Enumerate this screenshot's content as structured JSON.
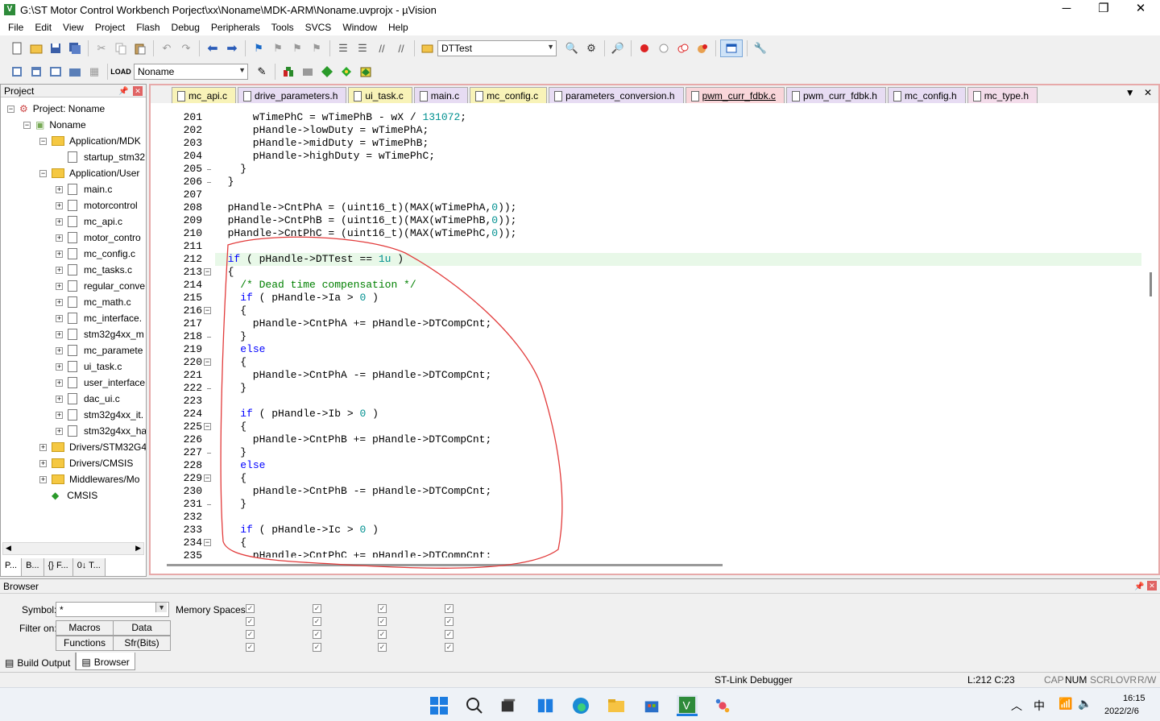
{
  "window": {
    "title": "G:\\ST Motor Control Workbench Porject\\xx\\Noname\\MDK-ARM\\Noname.uvprojx - µVision",
    "minimize": "─",
    "maximize": "❐",
    "close": "✕"
  },
  "menu": [
    "File",
    "Edit",
    "View",
    "Project",
    "Flash",
    "Debug",
    "Peripherals",
    "Tools",
    "SVCS",
    "Window",
    "Help"
  ],
  "toolbar": {
    "find_combo": "DTTest",
    "target_combo": "Noname"
  },
  "project": {
    "title": "Project",
    "tree": [
      {
        "label": "Project: Noname",
        "level": 0,
        "kind": "root",
        "exp": "−"
      },
      {
        "label": "Noname",
        "level": 1,
        "kind": "target",
        "exp": "−"
      },
      {
        "label": "Application/MDK",
        "level": 2,
        "kind": "folder",
        "exp": "−"
      },
      {
        "label": "startup_stm32",
        "level": 3,
        "kind": "file",
        "exp": ""
      },
      {
        "label": "Application/User",
        "level": 2,
        "kind": "folder",
        "exp": "−"
      },
      {
        "label": "main.c",
        "level": 3,
        "kind": "file",
        "exp": "+"
      },
      {
        "label": "motorcontrol",
        "level": 3,
        "kind": "file",
        "exp": "+"
      },
      {
        "label": "mc_api.c",
        "level": 3,
        "kind": "file",
        "exp": "+"
      },
      {
        "label": "motor_contro",
        "level": 3,
        "kind": "file",
        "exp": "+"
      },
      {
        "label": "mc_config.c",
        "level": 3,
        "kind": "file",
        "exp": "+"
      },
      {
        "label": "mc_tasks.c",
        "level": 3,
        "kind": "file",
        "exp": "+"
      },
      {
        "label": "regular_conve",
        "level": 3,
        "kind": "file",
        "exp": "+"
      },
      {
        "label": "mc_math.c",
        "level": 3,
        "kind": "file",
        "exp": "+"
      },
      {
        "label": "mc_interface.",
        "level": 3,
        "kind": "file",
        "exp": "+"
      },
      {
        "label": "stm32g4xx_m",
        "level": 3,
        "kind": "file",
        "exp": "+"
      },
      {
        "label": "mc_paramete",
        "level": 3,
        "kind": "file",
        "exp": "+"
      },
      {
        "label": "ui_task.c",
        "level": 3,
        "kind": "file",
        "exp": "+"
      },
      {
        "label": "user_interface",
        "level": 3,
        "kind": "file",
        "exp": "+"
      },
      {
        "label": "dac_ui.c",
        "level": 3,
        "kind": "file",
        "exp": "+"
      },
      {
        "label": "stm32g4xx_it.",
        "level": 3,
        "kind": "file",
        "exp": "+"
      },
      {
        "label": "stm32g4xx_ha",
        "level": 3,
        "kind": "file",
        "exp": "+"
      },
      {
        "label": "Drivers/STM32G4",
        "level": 2,
        "kind": "folder",
        "exp": "+"
      },
      {
        "label": "Drivers/CMSIS",
        "level": 2,
        "kind": "folder",
        "exp": "+"
      },
      {
        "label": "Middlewares/Mo",
        "level": 2,
        "kind": "folder",
        "exp": "+"
      },
      {
        "label": "CMSIS",
        "level": 2,
        "kind": "gem",
        "exp": ""
      }
    ],
    "tabs": [
      "P...",
      "B...",
      "{} F...",
      "0↓ T..."
    ]
  },
  "editor": {
    "tabs": [
      {
        "label": "mc_api.c",
        "color": "#f8f3b8",
        "active": false
      },
      {
        "label": "drive_parameters.h",
        "color": "#e7dcf3",
        "active": false
      },
      {
        "label": "ui_task.c",
        "color": "#f8f3b8",
        "active": false
      },
      {
        "label": "main.c",
        "color": "#e7dcf3",
        "active": false
      },
      {
        "label": "mc_config.c",
        "color": "#f8f3b8",
        "active": false
      },
      {
        "label": "parameters_conversion.h",
        "color": "#e7dcf3",
        "active": false
      },
      {
        "label": "pwm_curr_fdbk.c",
        "color": "#f9d6da",
        "active": true
      },
      {
        "label": "pwm_curr_fdbk.h",
        "color": "#e7dcf3",
        "active": false
      },
      {
        "label": "mc_config.h",
        "color": "#e7dcf3",
        "active": false
      },
      {
        "label": "mc_type.h",
        "color": "#f3dcea",
        "active": false
      }
    ],
    "lines": [
      {
        "n": "201",
        "fold": "",
        "html": "      wTimePhC = wTimePhB - wX / <span class='num'>131072</span>;"
      },
      {
        "n": "202",
        "fold": "",
        "html": "      pHandle->lowDuty = wTimePhA;"
      },
      {
        "n": "203",
        "fold": "",
        "html": "      pHandle->midDuty = wTimePhB;"
      },
      {
        "n": "204",
        "fold": "",
        "html": "      pHandle->highDuty = wTimePhC;"
      },
      {
        "n": "205",
        "fold": "end",
        "html": "    }"
      },
      {
        "n": "206",
        "fold": "end",
        "html": "  }"
      },
      {
        "n": "207",
        "fold": "",
        "html": ""
      },
      {
        "n": "208",
        "fold": "",
        "html": "  pHandle->CntPhA = (uint16_t)(MAX(wTimePhA,<span class='num'>0</span>));"
      },
      {
        "n": "209",
        "fold": "",
        "html": "  pHandle->CntPhB = (uint16_t)(MAX(wTimePhB,<span class='num'>0</span>));"
      },
      {
        "n": "210",
        "fold": "",
        "html": "  pHandle->CntPhC = (uint16_t)(MAX(wTimePhC,<span class='num'>0</span>));"
      },
      {
        "n": "211",
        "fold": "",
        "html": ""
      },
      {
        "n": "212",
        "fold": "",
        "html": "  <span class='kw'>if</span> ( pHandle->DTTest == <span class='num'>1u</span> )",
        "cur": true
      },
      {
        "n": "213",
        "fold": "box",
        "html": "  {"
      },
      {
        "n": "214",
        "fold": "",
        "html": "    <span class='cm'>/* Dead time compensation */</span>"
      },
      {
        "n": "215",
        "fold": "",
        "html": "    <span class='kw'>if</span> ( pHandle->Ia > <span class='num'>0</span> )"
      },
      {
        "n": "216",
        "fold": "box",
        "html": "    {"
      },
      {
        "n": "217",
        "fold": "",
        "html": "      pHandle->CntPhA += pHandle->DTCompCnt;"
      },
      {
        "n": "218",
        "fold": "end",
        "html": "    }"
      },
      {
        "n": "219",
        "fold": "",
        "html": "    <span class='kw'>else</span>"
      },
      {
        "n": "220",
        "fold": "box",
        "html": "    {"
      },
      {
        "n": "221",
        "fold": "",
        "html": "      pHandle->CntPhA -= pHandle->DTCompCnt;"
      },
      {
        "n": "222",
        "fold": "end",
        "html": "    }"
      },
      {
        "n": "223",
        "fold": "",
        "html": ""
      },
      {
        "n": "224",
        "fold": "",
        "html": "    <span class='kw'>if</span> ( pHandle->Ib > <span class='num'>0</span> )"
      },
      {
        "n": "225",
        "fold": "box",
        "html": "    {"
      },
      {
        "n": "226",
        "fold": "",
        "html": "      pHandle->CntPhB += pHandle->DTCompCnt;"
      },
      {
        "n": "227",
        "fold": "end",
        "html": "    }"
      },
      {
        "n": "228",
        "fold": "",
        "html": "    <span class='kw'>else</span>"
      },
      {
        "n": "229",
        "fold": "box",
        "html": "    {"
      },
      {
        "n": "230",
        "fold": "",
        "html": "      pHandle->CntPhB -= pHandle->DTCompCnt;"
      },
      {
        "n": "231",
        "fold": "end",
        "html": "    }"
      },
      {
        "n": "232",
        "fold": "",
        "html": ""
      },
      {
        "n": "233",
        "fold": "",
        "html": "    <span class='kw'>if</span> ( pHandle->Ic > <span class='num'>0</span> )"
      },
      {
        "n": "234",
        "fold": "box",
        "html": "    {"
      },
      {
        "n": "235",
        "fold": "",
        "html": "      pHandle->CntPhC += pHandle->DTCompCnt;"
      }
    ]
  },
  "browser": {
    "title": "Browser",
    "symbol_label": "Symbol:",
    "symbol_value": "*",
    "filter_label": "Filter on:",
    "memory_label": "Memory Spaces:",
    "btn_macros": "Macros",
    "btn_data": "Data",
    "btn_functions": "Functions",
    "btn_sfr": "Sfr(Bits)"
  },
  "bottom_tabs": {
    "build": "Build Output",
    "browser": "Browser"
  },
  "status": {
    "debugger": "ST-Link Debugger",
    "pos": "L:212 C:23",
    "caps": "CAP",
    "num": "NUM",
    "scrl": "SCRL",
    "ovr": "OVR",
    "rw": "R/W"
  },
  "taskbar": {
    "time": "16:15",
    "date": "2022/2/6",
    "ime": "中"
  }
}
